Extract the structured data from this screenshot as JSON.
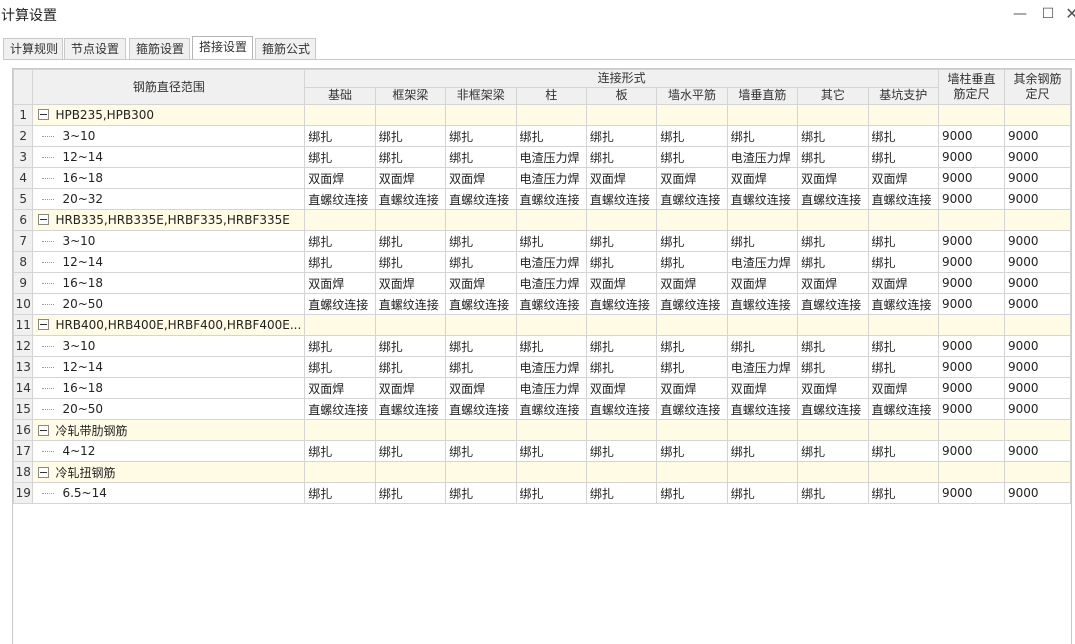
{
  "window": {
    "title": "计算设置",
    "minimize": "—",
    "maximize": "☐",
    "close": "✕"
  },
  "tabs": [
    {
      "label": "计算规则",
      "active": false
    },
    {
      "label": "节点设置",
      "active": false
    },
    {
      "label": "箍筋设置",
      "active": false
    },
    {
      "label": "搭接设置",
      "active": true
    },
    {
      "label": "箍筋公式",
      "active": false
    }
  ],
  "table": {
    "header": {
      "range": "钢筋直径范围",
      "group": "连接形式",
      "columns": [
        "基础",
        "框架梁",
        "非框架梁",
        "柱",
        "板",
        "墙水平筋",
        "墙垂直筋",
        "其它",
        "基坑支护"
      ],
      "wall_col": "墙柱垂直筋定尺",
      "other_col": "其余钢筋定尺"
    },
    "rows": [
      {
        "num": "1",
        "group": true,
        "label": "HPB235,HPB300"
      },
      {
        "num": "2",
        "label": "3~10",
        "cells": [
          "绑扎",
          "绑扎",
          "绑扎",
          "绑扎",
          "绑扎",
          "绑扎",
          "绑扎",
          "绑扎",
          "绑扎",
          "9000",
          "9000"
        ]
      },
      {
        "num": "3",
        "label": "12~14",
        "cells": [
          "绑扎",
          "绑扎",
          "绑扎",
          "电渣压力焊",
          "绑扎",
          "绑扎",
          "电渣压力焊",
          "绑扎",
          "绑扎",
          "9000",
          "9000"
        ]
      },
      {
        "num": "4",
        "label": "16~18",
        "cells": [
          "双面焊",
          "双面焊",
          "双面焊",
          "电渣压力焊",
          "双面焊",
          "双面焊",
          "双面焊",
          "双面焊",
          "双面焊",
          "9000",
          "9000"
        ]
      },
      {
        "num": "5",
        "label": "20~32",
        "cells": [
          "直螺纹连接",
          "直螺纹连接",
          "直螺纹连接",
          "直螺纹连接",
          "直螺纹连接",
          "直螺纹连接",
          "直螺纹连接",
          "直螺纹连接",
          "直螺纹连接",
          "9000",
          "9000"
        ]
      },
      {
        "num": "6",
        "group": true,
        "label": "HRB335,HRB335E,HRBF335,HRBF335E"
      },
      {
        "num": "7",
        "label": "3~10",
        "cells": [
          "绑扎",
          "绑扎",
          "绑扎",
          "绑扎",
          "绑扎",
          "绑扎",
          "绑扎",
          "绑扎",
          "绑扎",
          "9000",
          "9000"
        ]
      },
      {
        "num": "8",
        "label": "12~14",
        "cells": [
          "绑扎",
          "绑扎",
          "绑扎",
          "电渣压力焊",
          "绑扎",
          "绑扎",
          "电渣压力焊",
          "绑扎",
          "绑扎",
          "9000",
          "9000"
        ]
      },
      {
        "num": "9",
        "label": "16~18",
        "cells": [
          "双面焊",
          "双面焊",
          "双面焊",
          "电渣压力焊",
          "双面焊",
          "双面焊",
          "双面焊",
          "双面焊",
          "双面焊",
          "9000",
          "9000"
        ]
      },
      {
        "num": "10",
        "label": "20~50",
        "cells": [
          "直螺纹连接",
          "直螺纹连接",
          "直螺纹连接",
          "直螺纹连接",
          "直螺纹连接",
          "直螺纹连接",
          "直螺纹连接",
          "直螺纹连接",
          "直螺纹连接",
          "9000",
          "9000"
        ]
      },
      {
        "num": "11",
        "group": true,
        "label": "HRB400,HRB400E,HRBF400,HRBF400E..."
      },
      {
        "num": "12",
        "label": "3~10",
        "cells": [
          "绑扎",
          "绑扎",
          "绑扎",
          "绑扎",
          "绑扎",
          "绑扎",
          "绑扎",
          "绑扎",
          "绑扎",
          "9000",
          "9000"
        ]
      },
      {
        "num": "13",
        "label": "12~14",
        "cells": [
          "绑扎",
          "绑扎",
          "绑扎",
          "电渣压力焊",
          "绑扎",
          "绑扎",
          "电渣压力焊",
          "绑扎",
          "绑扎",
          "9000",
          "9000"
        ]
      },
      {
        "num": "14",
        "label": "16~18",
        "cells": [
          "双面焊",
          "双面焊",
          "双面焊",
          "电渣压力焊",
          "双面焊",
          "双面焊",
          "双面焊",
          "双面焊",
          "双面焊",
          "9000",
          "9000"
        ]
      },
      {
        "num": "15",
        "label": "20~50",
        "cells": [
          "直螺纹连接",
          "直螺纹连接",
          "直螺纹连接",
          "直螺纹连接",
          "直螺纹连接",
          "直螺纹连接",
          "直螺纹连接",
          "直螺纹连接",
          "直螺纹连接",
          "9000",
          "9000"
        ]
      },
      {
        "num": "16",
        "group": true,
        "label": "冷轧带肋钢筋"
      },
      {
        "num": "17",
        "label": "4~12",
        "cells": [
          "绑扎",
          "绑扎",
          "绑扎",
          "绑扎",
          "绑扎",
          "绑扎",
          "绑扎",
          "绑扎",
          "绑扎",
          "9000",
          "9000"
        ]
      },
      {
        "num": "18",
        "group": true,
        "label": "冷轧扭钢筋"
      },
      {
        "num": "19",
        "label": "6.5~14",
        "cells": [
          "绑扎",
          "绑扎",
          "绑扎",
          "绑扎",
          "绑扎",
          "绑扎",
          "绑扎",
          "绑扎",
          "绑扎",
          "9000",
          "9000"
        ]
      }
    ]
  }
}
